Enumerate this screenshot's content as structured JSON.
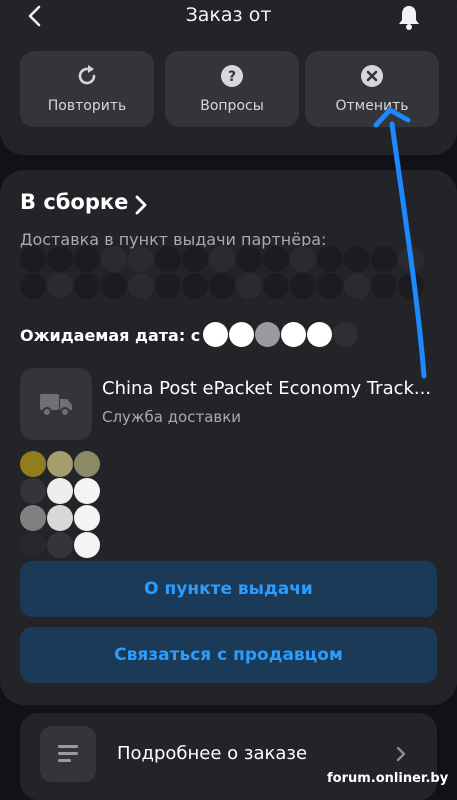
{
  "header": {
    "title": "Заказ от",
    "back_icon": "back-chevron-icon",
    "bell_icon": "bell-icon"
  },
  "actions": [
    {
      "label": "Повторить",
      "icon": "repeat-icon"
    },
    {
      "label": "Вопросы",
      "icon": "question-icon"
    },
    {
      "label": "Отменить",
      "icon": "cancel-icon"
    }
  ],
  "status": {
    "title": "В сборке",
    "delivery_text": "Доставка в пункт выдачи партнёра:",
    "expected_label": "Ожидаемая дата: с"
  },
  "carrier": {
    "name": "China Post ePacket Economy Track...",
    "subtitle": "Служба доставки",
    "icon": "truck-icon"
  },
  "buttons": {
    "pickup_point": "О пункте выдачи",
    "contact_seller": "Связаться с продавцом"
  },
  "details": {
    "label": "Подробнее о заказе",
    "icon": "list-icon"
  },
  "watermark": "forum.onliner.by",
  "colors": {
    "background": "#111216",
    "card": "#232428",
    "button": "#34353a",
    "accent": "#2d9cff",
    "accent_button": "#1a3a57",
    "annotation_arrow": "#1e88ff"
  }
}
